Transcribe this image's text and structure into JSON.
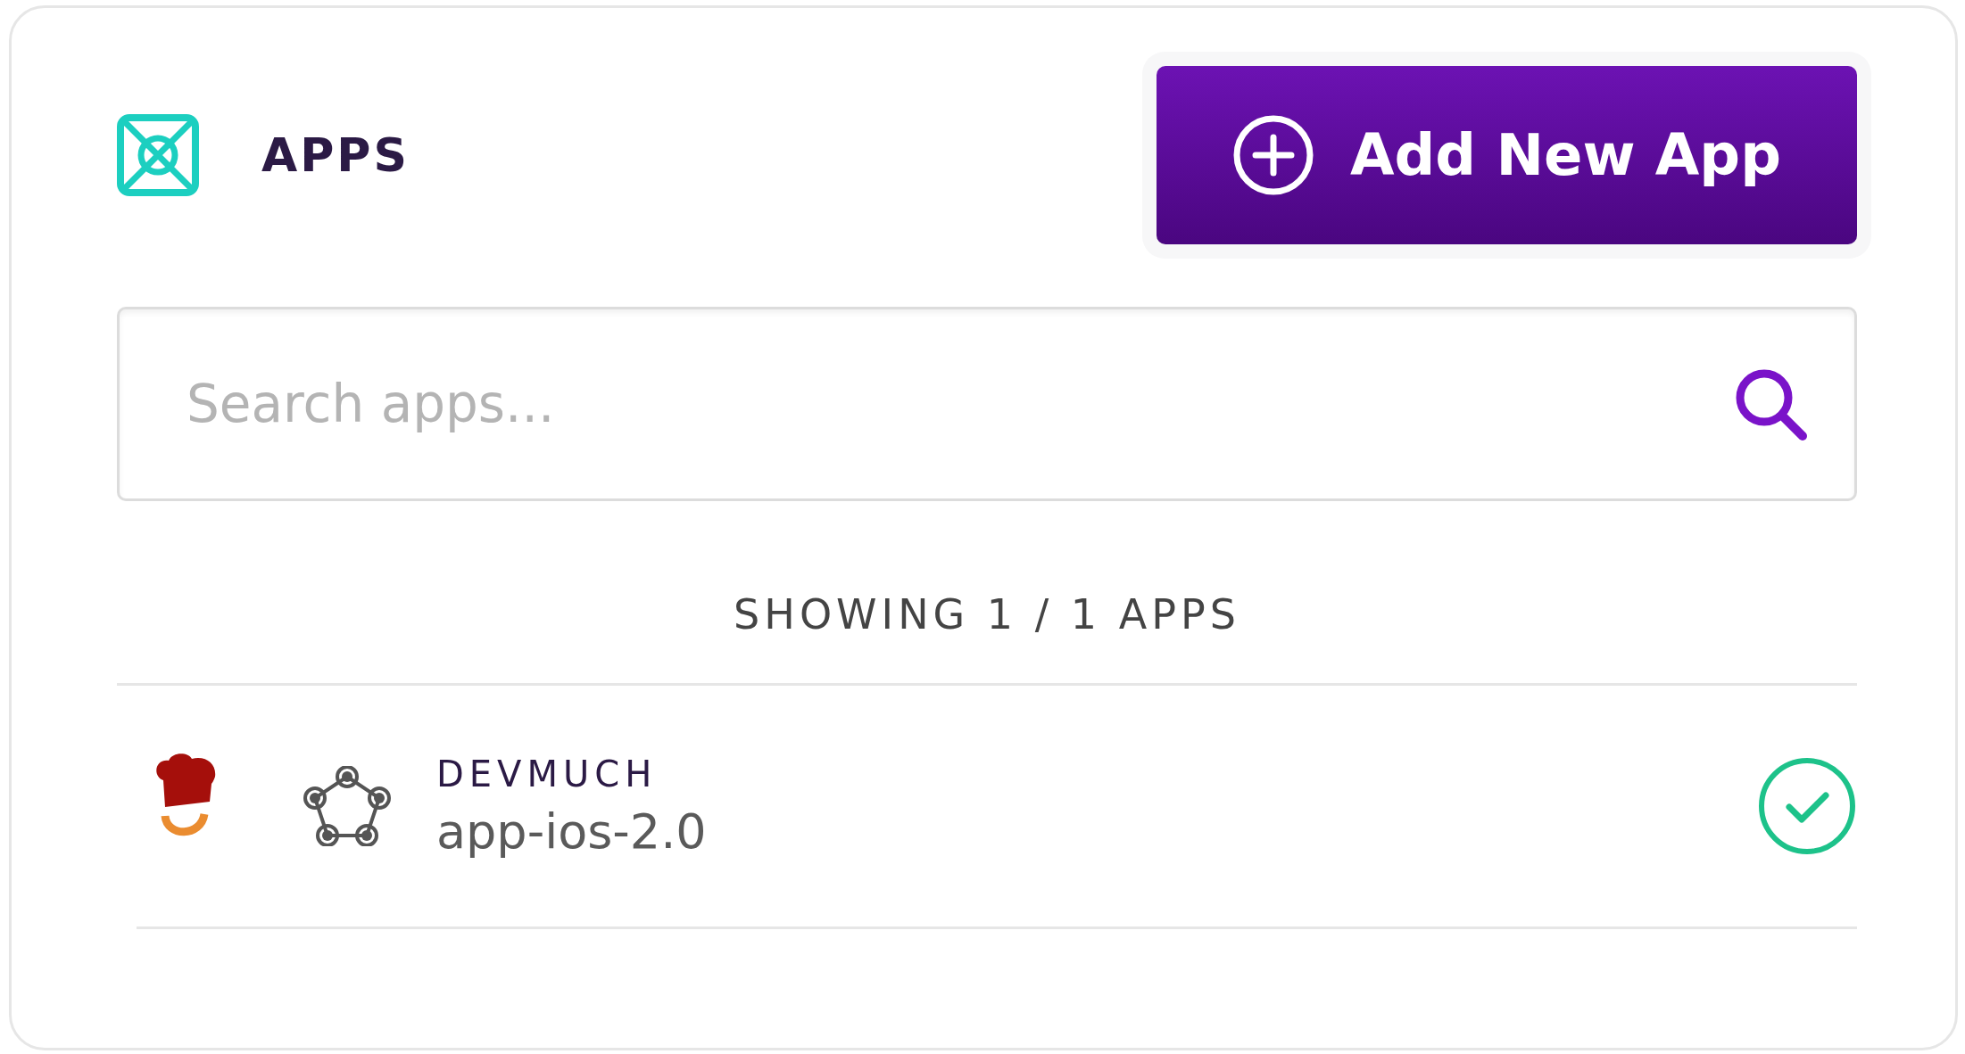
{
  "header": {
    "title": "APPS"
  },
  "add_button": {
    "label": "Add New App"
  },
  "search": {
    "placeholder": "Search apps..."
  },
  "summary": "SHOWING 1 / 1 APPS",
  "apps": [
    {
      "team": "DEVMUCH",
      "name": "app-ios-2.0",
      "verified": true
    }
  ]
}
